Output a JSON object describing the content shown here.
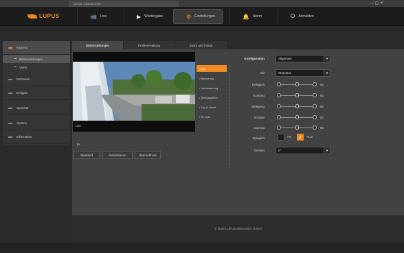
{
  "browser": {
    "tab_title": "LUPUS - Netzwerk HD",
    "controls": "—  ▢  ✕"
  },
  "header": {
    "logo_text": "LUPUS",
    "nav": [
      {
        "label": "Live",
        "icon": "camera-icon"
      },
      {
        "label": "Wiedergabe",
        "icon": "play-icon"
      },
      {
        "label": "Einstellungen",
        "icon": "gear-icon"
      },
      {
        "label": "Alarm",
        "icon": "bell-icon"
      },
      {
        "label": "Abmelden",
        "icon": "power-icon"
      }
    ]
  },
  "sidebar": {
    "items": [
      {
        "label": "Kamera"
      },
      {
        "label": "Bildeinstellungen"
      },
      {
        "label": "Video"
      },
      {
        "label": "Netzwerk"
      },
      {
        "label": "Ereignis"
      },
      {
        "label": "Speicher"
      },
      {
        "label": "System"
      },
      {
        "label": "Information"
      }
    ]
  },
  "tabs": [
    {
      "label": "Bildeinstellungen"
    },
    {
      "label": "Profilverwaltung"
    },
    {
      "label": "Zoom und Fokus"
    }
  ],
  "preview": {
    "osd_text": "0001",
    "index_label": "IH"
  },
  "buttons": {
    "standard": "Standard",
    "refresh": "Aktualisieren",
    "apply": "Übernehmen"
  },
  "osd_menu": [
    {
      "label": "• Bild"
    },
    {
      "label": "• Belichtung"
    },
    {
      "label": "• Verbesserung"
    },
    {
      "label": "• Weißabgleich"
    },
    {
      "label": "• Tag & Nacht"
    },
    {
      "label": "• IR Licht"
    }
  ],
  "form": {
    "config_label": "Konfiguration",
    "config_value": "Allgemein",
    "stil_label": "Stil",
    "stil_value": "Standard",
    "sliders": [
      {
        "label": "Helligkeit",
        "value": "50",
        "level": 0.5
      },
      {
        "label": "Kontrast",
        "value": "50",
        "level": 0.5
      },
      {
        "label": "Sättigung",
        "value": "50",
        "level": 0.5
      },
      {
        "label": "Schärfe",
        "value": "50",
        "level": 0.5
      },
      {
        "label": "Gamma",
        "value": "50",
        "level": 0.5
      }
    ],
    "mirror_label": "Spiegeln",
    "mirror_on": "AN",
    "mirror_off": "AUS",
    "rotate_label": "Drehen",
    "rotate_value": "0°"
  },
  "footer": {
    "copyright": "© 2022 LUPUS-Electronics GmbH"
  },
  "colors": {
    "accent": "#f08a24"
  }
}
